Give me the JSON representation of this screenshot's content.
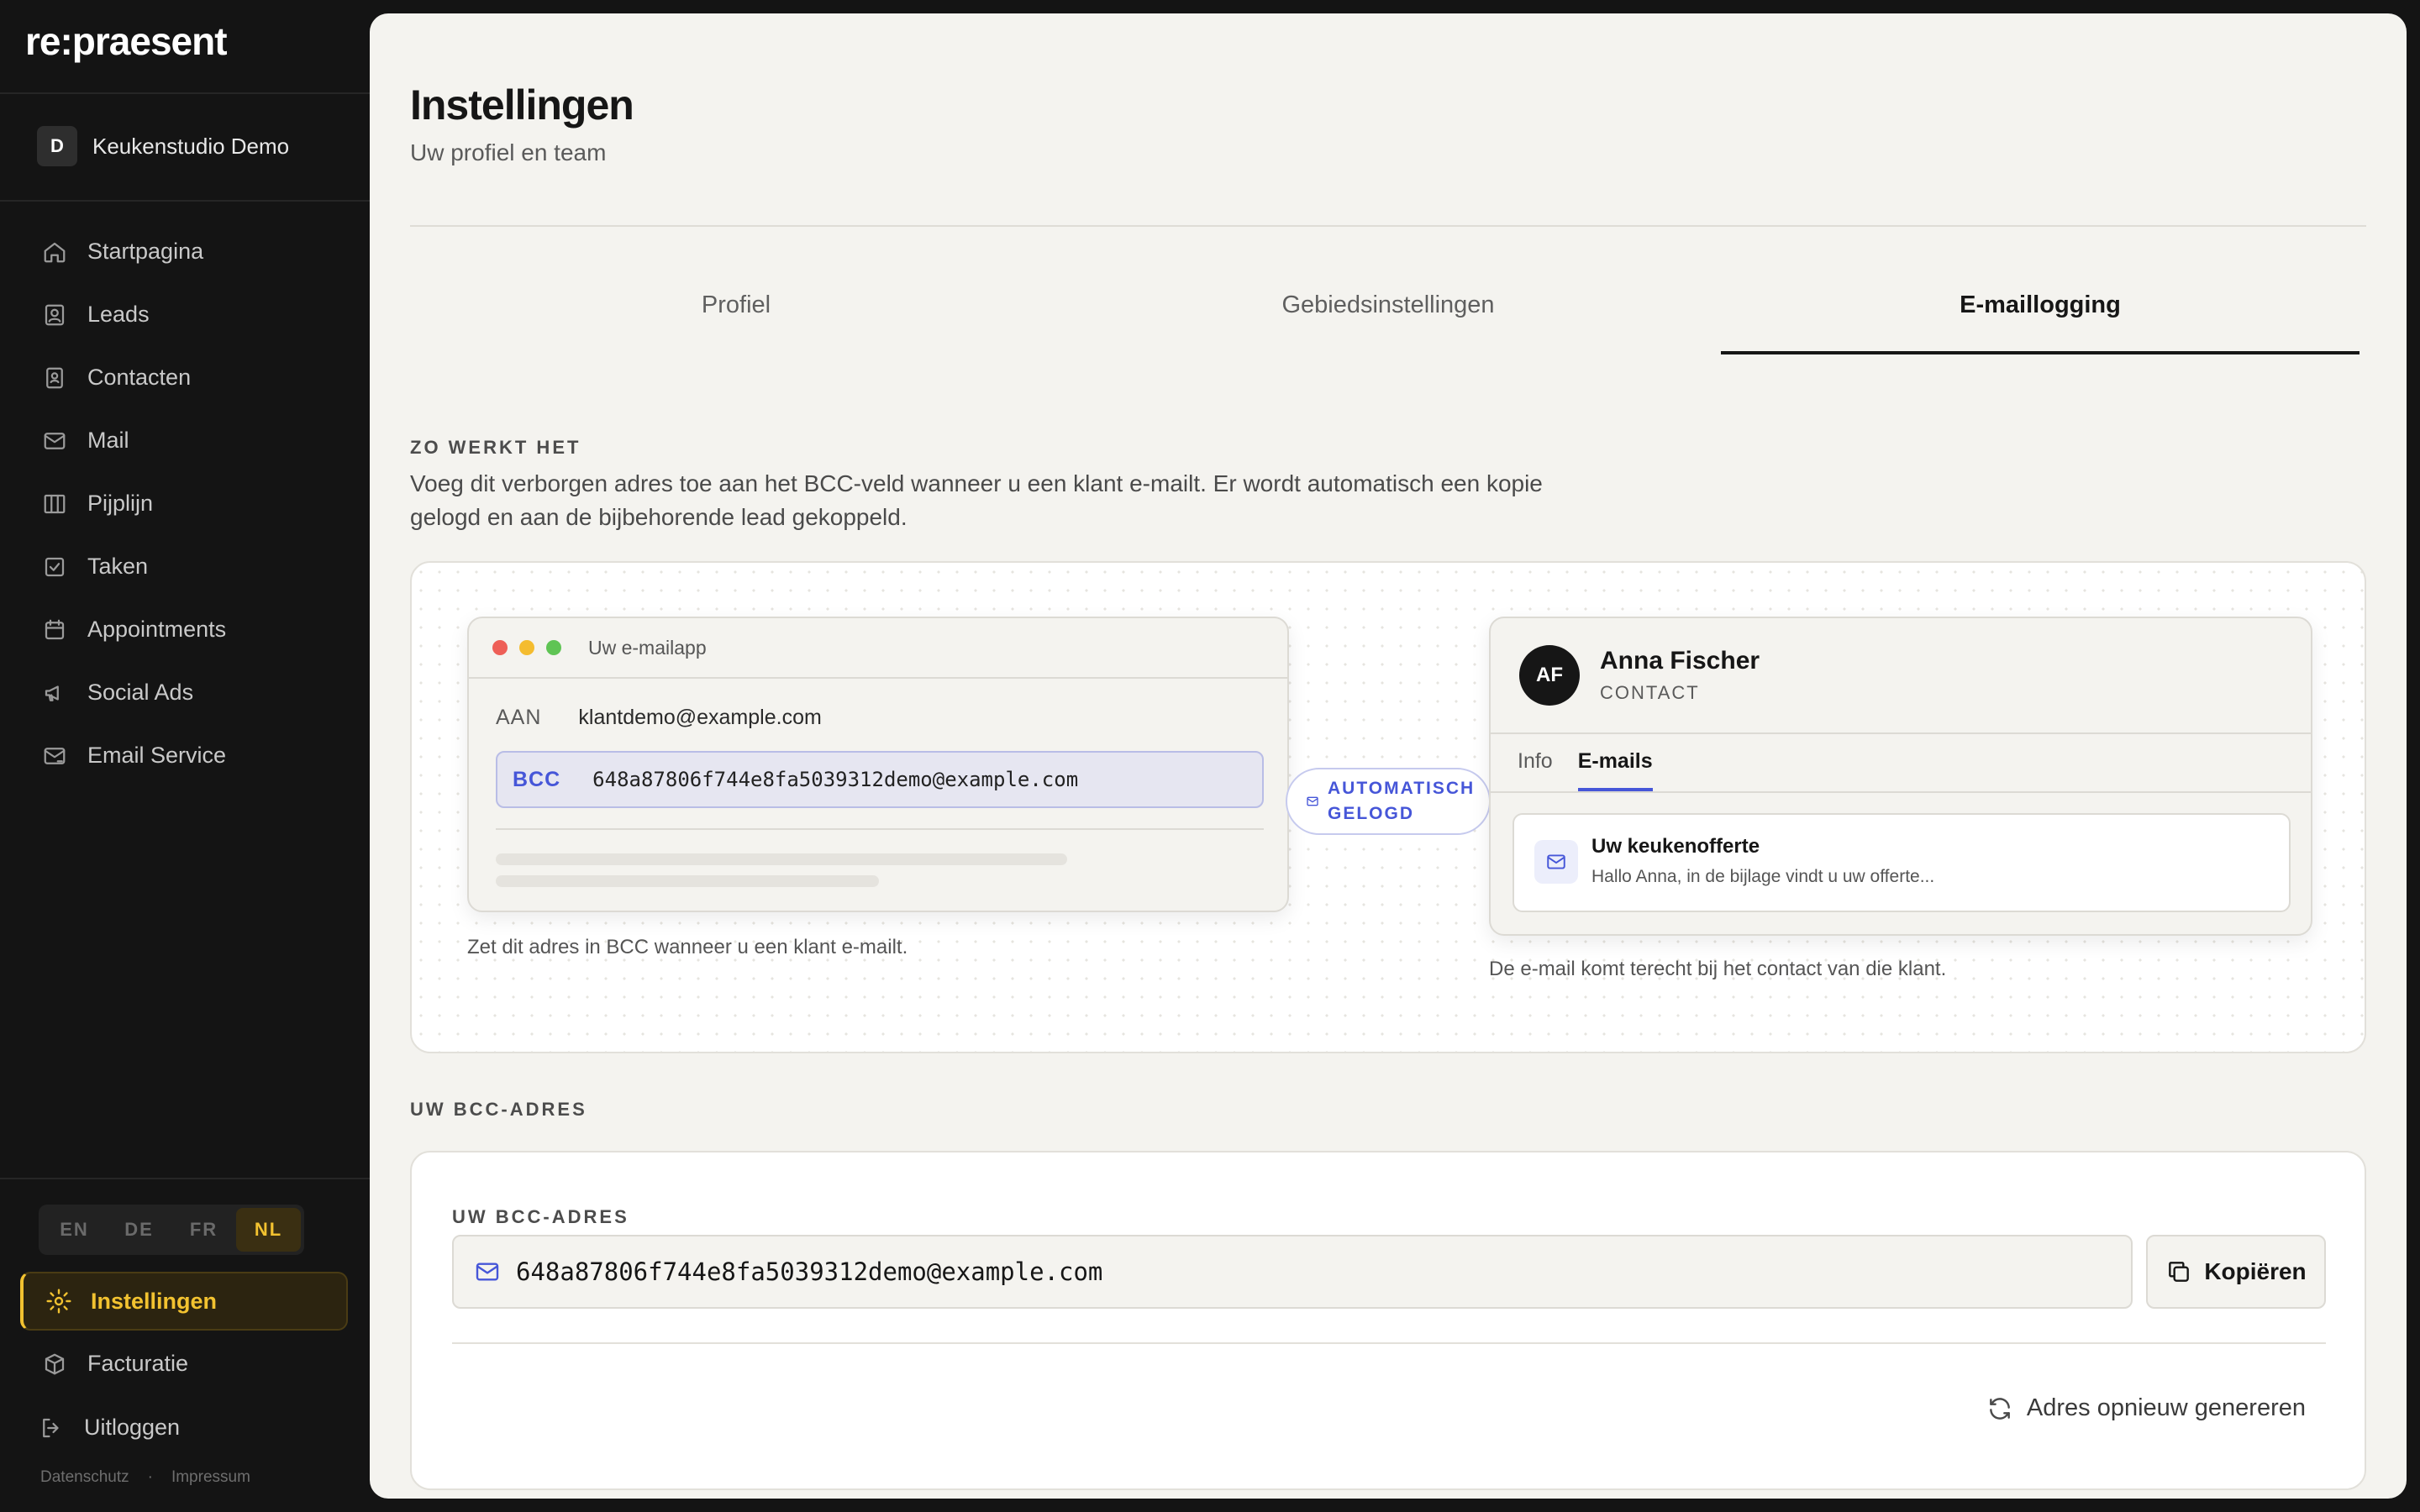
{
  "app": {
    "logo": "re:praesent"
  },
  "workspace": {
    "initial": "D",
    "name": "Keukenstudio Demo"
  },
  "nav": [
    {
      "label": "Startpagina",
      "icon": "home-icon"
    },
    {
      "label": "Leads",
      "icon": "user-badge-icon"
    },
    {
      "label": "Contacten",
      "icon": "contact-book-icon"
    },
    {
      "label": "Mail",
      "icon": "mail-icon"
    },
    {
      "label": "Pijplijn",
      "icon": "columns-icon"
    },
    {
      "label": "Taken",
      "icon": "checkbox-icon"
    },
    {
      "label": "Appointments",
      "icon": "calendar-icon"
    },
    {
      "label": "Social Ads",
      "icon": "megaphone-icon"
    },
    {
      "label": "Email Service",
      "icon": "mail-send-icon"
    }
  ],
  "languages": {
    "options": [
      "EN",
      "DE",
      "FR",
      "NL"
    ],
    "selected": "NL",
    "selected_color": "#f2c230"
  },
  "bottom_nav": {
    "settings": "Instellingen",
    "billing": "Facturatie",
    "logout": "Uitloggen"
  },
  "footer": {
    "privacy": "Datenschutz",
    "separator": "·",
    "imprint": "Impressum"
  },
  "header": {
    "title": "Instellingen",
    "subtitle": "Uw profiel en team"
  },
  "tabs": [
    {
      "label": "Profiel",
      "active": false
    },
    {
      "label": "Gebiedsinstellingen",
      "active": false
    },
    {
      "label": "E-maillogging",
      "active": true
    }
  ],
  "how_it_works": {
    "label": "ZO WERKT HET",
    "text": "Voeg dit verborgen adres toe aan het BCC-veld wanneer u een klant e-mailt. Er wordt automatisch een kopie gelogd en aan de bijbehorende lead gekoppeld."
  },
  "demo": {
    "mail_app": {
      "title": "Uw e-mailapp",
      "to_label": "AAN",
      "to_value": "klantdemo@example.com",
      "bcc_label": "BCC",
      "bcc_value": "648a87806f744e8fa5039312demo@example.com",
      "caption": "Zet dit adres in BCC wanneer u een klant e-mailt."
    },
    "auto_badge": {
      "line1": "AUTOMATISCH",
      "line2": "GELOGD"
    },
    "contact": {
      "initials": "AF",
      "name": "Anna Fischer",
      "role": "CONTACT",
      "tabs": [
        "Info",
        "E-mails"
      ],
      "active_tab": "E-mails",
      "email_subject": "Uw keukenofferte",
      "email_preview": "Hallo Anna, in de bijlage vindt u uw offerte...",
      "caption": "De e-mail komt terecht bij het contact van die klant."
    }
  },
  "bcc_section": {
    "label": "UW BCC-ADRES",
    "field_label": "UW BCC-ADRES",
    "address": "648a87806f744e8fa5039312demo@example.com",
    "copy_label": "Kopiëren",
    "regenerate_label": "Adres opnieuw genereren"
  },
  "colors": {
    "accent": "#4656d8",
    "active_nav": "#f2c230",
    "sidebar_bg": "#141414",
    "main_bg": "#f4f3ef"
  }
}
